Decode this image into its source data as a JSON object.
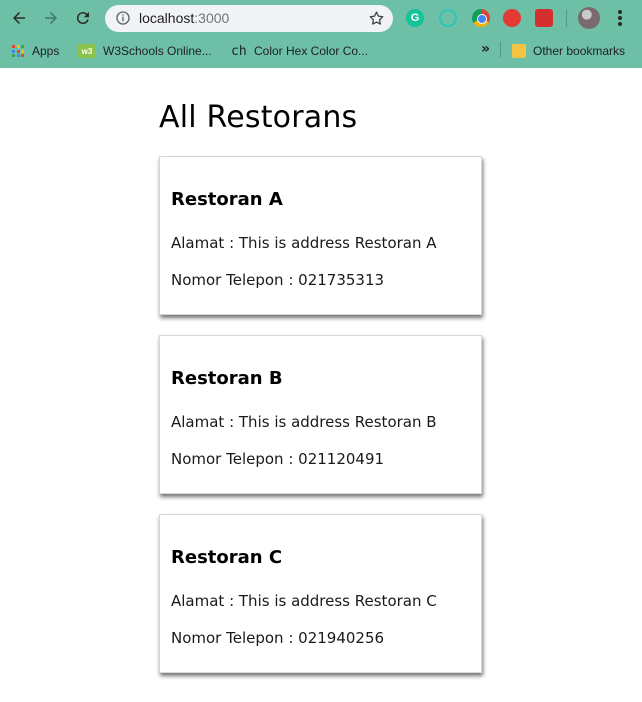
{
  "browser": {
    "url_host": "localhost",
    "url_port": ":3000",
    "bookmarks": [
      {
        "label": "Apps",
        "icon": "apps-grid-icon"
      },
      {
        "label": "W3Schools Online...",
        "icon": "w3schools-icon"
      },
      {
        "label": "Color Hex Color Co...",
        "icon": "colorhex-icon"
      }
    ],
    "other_bookmarks": "Other bookmarks",
    "overflow": "»",
    "extension_g": "G"
  },
  "page": {
    "title": "All Restorans",
    "restaurants": [
      {
        "name": "Restoran A",
        "address": "Alamat : This is address Restoran A",
        "phone": "Nomor Telepon : 021735313"
      },
      {
        "name": "Restoran B",
        "address": "Alamat : This is address Restoran B",
        "phone": "Nomor Telepon : 021120491"
      },
      {
        "name": "Restoran C",
        "address": "Alamat : This is address Restoran C",
        "phone": "Nomor Telepon : 021940256"
      }
    ]
  },
  "colors": {
    "chrome": "#6dbfa6",
    "omnibox": "#f1f3f4"
  }
}
